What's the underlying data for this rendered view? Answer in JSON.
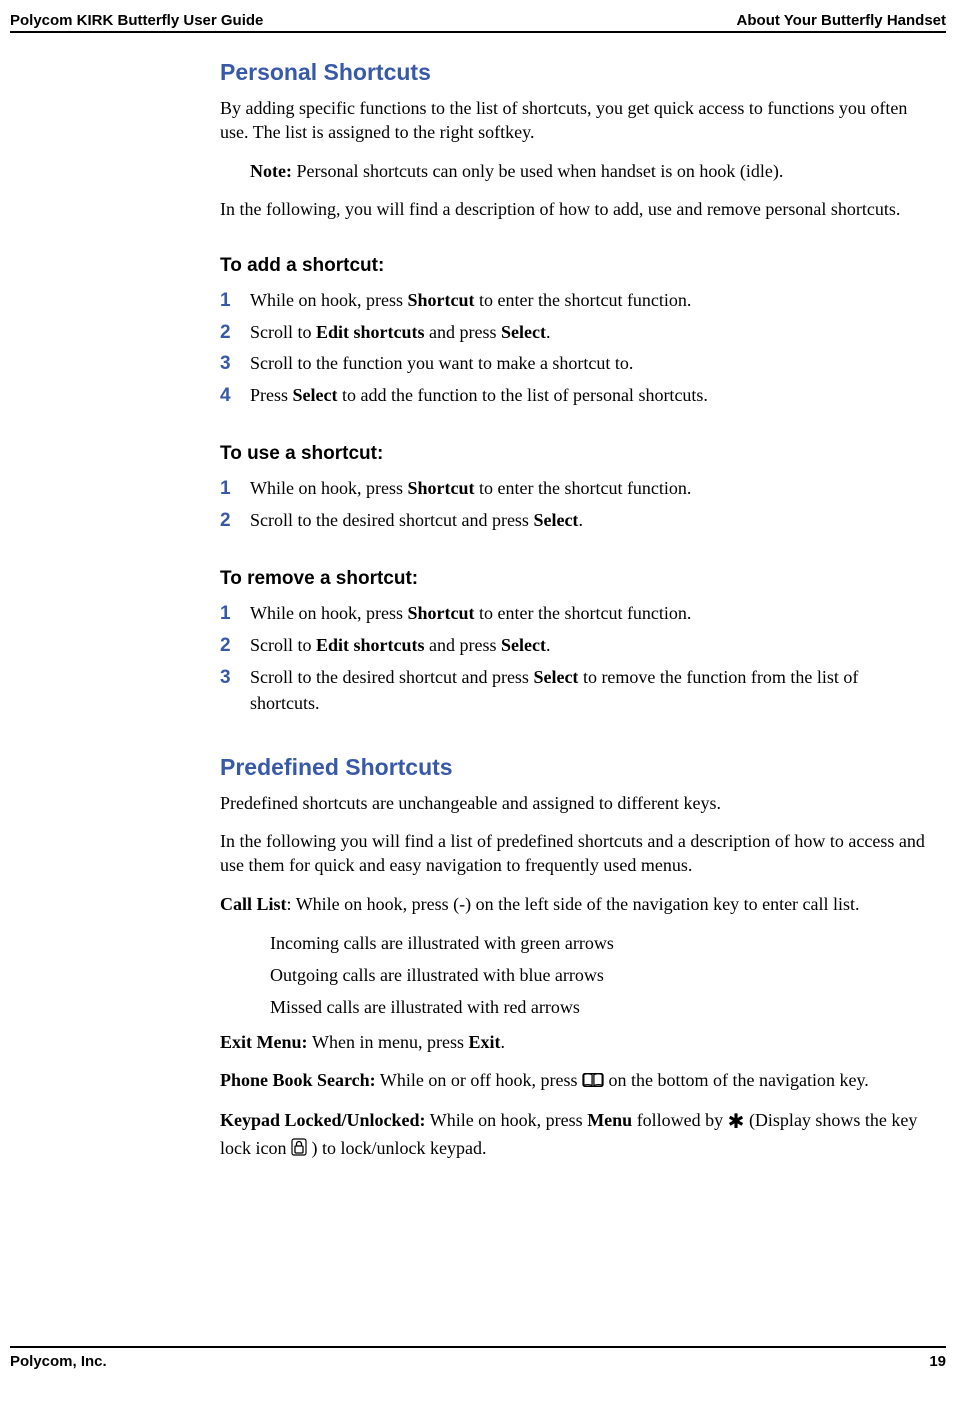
{
  "header": {
    "left": "Polycom KIRK Butterfly User Guide",
    "right": "About Your Butterfly Handset"
  },
  "sections": {
    "personal": {
      "title": "Personal Shortcuts",
      "intro": "By adding specific functions to the list of shortcuts, you get quick access to functions you often use. The list is assigned to the right softkey.",
      "note_label": "Note:",
      "note_text": " Personal shortcuts can only be used when handset is on hook (idle).",
      "lead": "In the following, you will find a description of how to add, use and remove personal shortcuts.",
      "add": {
        "heading": "To add a shortcut:",
        "steps": {
          "s1_a": "While on hook, press ",
          "s1_b": "Shortcut",
          "s1_c": " to enter the shortcut function.",
          "s2_a": "Scroll to ",
          "s2_b": "Edit shortcuts",
          "s2_c": " and press ",
          "s2_d": "Select",
          "s2_e": ".",
          "s3": "Scroll to the function you want to make a shortcut to.",
          "s4_a": "Press ",
          "s4_b": "Select",
          "s4_c": " to add the function to the list of personal shortcuts."
        }
      },
      "use": {
        "heading": "To use a shortcut:",
        "steps": {
          "s1_a": "While on hook, press ",
          "s1_b": "Shortcut",
          "s1_c": " to enter the shortcut function.",
          "s2_a": "Scroll to the desired shortcut and press ",
          "s2_b": "Select",
          "s2_c": "."
        }
      },
      "remove": {
        "heading": "To remove a shortcut:",
        "steps": {
          "s1_a": "While on hook, press ",
          "s1_b": "Shortcut",
          "s1_c": " to enter the shortcut function.",
          "s2_a": "Scroll to ",
          "s2_b": "Edit shortcuts",
          "s2_c": " and press ",
          "s2_d": "Select",
          "s2_e": ".",
          "s3_a": "Scroll to the desired shortcut and press ",
          "s3_b": "Select",
          "s3_c": " to remove the function from the list of shortcuts."
        }
      }
    },
    "predefined": {
      "title": "Predefined Shortcuts",
      "intro1": "Predefined shortcuts are unchangeable and assigned to different keys.",
      "intro2": "In the following you will find a list of predefined shortcuts and a description of how to access and use them for quick and easy navigation to frequently used menus.",
      "calllist_label": "Call List",
      "calllist_text": ": While on hook, press (-) on the left side of the navigation key to enter call list.",
      "bullets": {
        "b1": "Incoming calls are illustrated with green arrows",
        "b2": "Outgoing calls are illustrated with blue arrows",
        "b3": "Missed calls are illustrated with red arrows"
      },
      "exit_label": "Exit Menu",
      "exit_colon": ": ",
      "exit_text_a": "When in menu, press ",
      "exit_text_b": "Exit",
      "exit_text_c": ".",
      "phonebook_label": "Phone Book Search:",
      "phonebook_text_a": " While on or off hook, press ",
      "phonebook_text_b": " on the bottom of the navigation key.",
      "keypad_label": "Keypad Locked/Unlocked:",
      "keypad_text_a": " While on hook, press ",
      "keypad_text_b": "Menu",
      "keypad_text_c": " followed by ",
      "keypad_text_d": " (Display shows the key lock icon ",
      "keypad_text_e": " ) to lock/unlock keypad."
    }
  },
  "nums": {
    "n1": "1",
    "n2": "2",
    "n3": "3",
    "n4": "4"
  },
  "footer": {
    "left": "Polycom, Inc.",
    "right": "19"
  }
}
